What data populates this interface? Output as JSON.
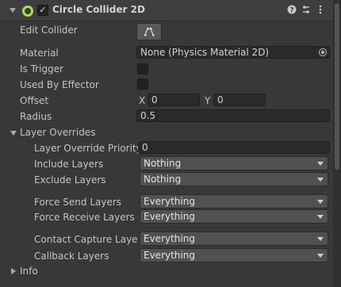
{
  "header": {
    "title": "Circle Collider 2D",
    "enabled": true,
    "icons": [
      "help-icon",
      "preset-icon",
      "more-options-icon"
    ]
  },
  "edit_collider": {
    "label": "Edit Collider",
    "icon": "edit-shape-icon"
  },
  "material": {
    "label": "Material",
    "value": "None (Physics Material 2D)",
    "icon": "object-picker-icon"
  },
  "is_trigger": {
    "label": "Is Trigger",
    "checked": false
  },
  "used_by_effector": {
    "label": "Used By Effector",
    "checked": false
  },
  "offset": {
    "label": "Offset",
    "x_label": "X",
    "x_value": "0",
    "y_label": "Y",
    "y_value": "0"
  },
  "radius": {
    "label": "Radius",
    "value": "0.5"
  },
  "layer_overrides": {
    "label": "Layer Overrides",
    "expanded": true,
    "priority": {
      "label": "Layer Override Priority",
      "value": "0"
    },
    "include_layers": {
      "label": "Include Layers",
      "value": "Nothing"
    },
    "exclude_layers": {
      "label": "Exclude Layers",
      "value": "Nothing"
    },
    "force_send_layers": {
      "label": "Force Send Layers",
      "value": "Everything"
    },
    "force_receive_layers": {
      "label": "Force Receive Layers",
      "value": "Everything"
    },
    "contact_capture_layers": {
      "label": "Contact Capture Layers",
      "value": "Everything"
    },
    "callback_layers": {
      "label": "Callback Layers",
      "value": "Everything"
    }
  },
  "info": {
    "label": "Info",
    "expanded": false
  }
}
